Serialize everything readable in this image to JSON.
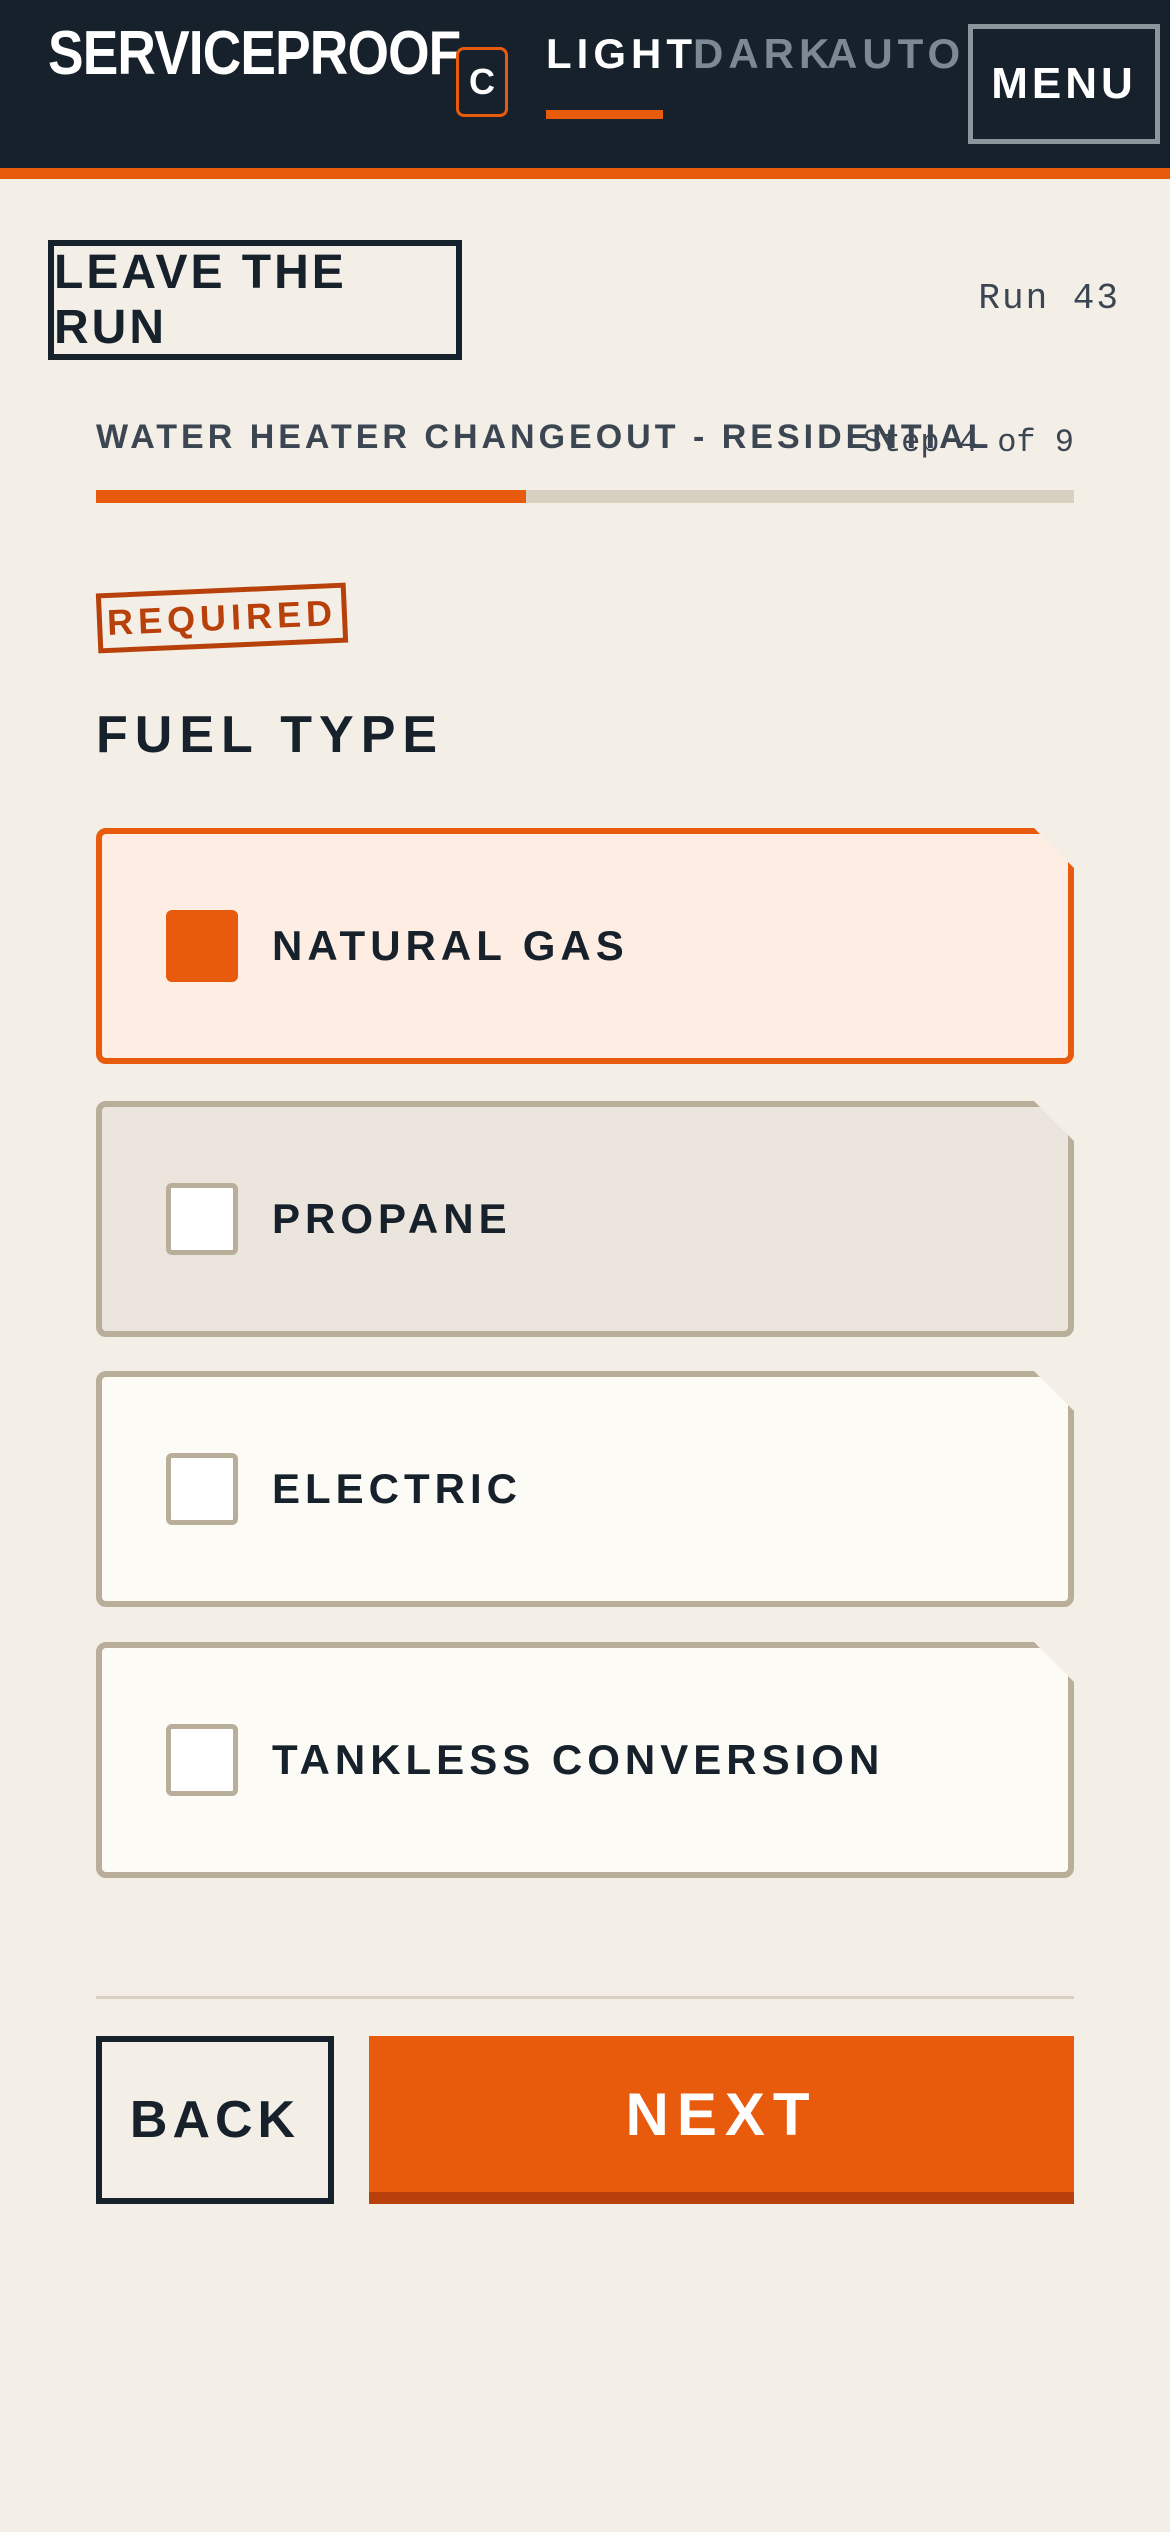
{
  "header": {
    "brand": "SERVICEPROOF",
    "theme_chip": "C",
    "tabs": [
      {
        "label": "LIGHT",
        "active": true
      },
      {
        "label": "DARK",
        "active": false
      },
      {
        "label": "AUTO",
        "active": false
      }
    ],
    "menu_label": "MENU"
  },
  "run": {
    "leave_label": "LEAVE THE RUN",
    "run_number": "Run 43",
    "task_title": "WATER HEATER CHANGEOUT - RESIDENTIAL",
    "step_text": "Step 4 of 9",
    "progress_fraction": 0.44
  },
  "question": {
    "badge": "REQUIRED",
    "title": "FUEL TYPE",
    "options": [
      {
        "label": "NATURAL GAS",
        "selected": true
      },
      {
        "label": "PROPANE",
        "selected": false
      },
      {
        "label": "ELECTRIC",
        "selected": false
      },
      {
        "label": "TANKLESS CONVERSION",
        "selected": false
      }
    ]
  },
  "footer": {
    "back_label": "BACK",
    "next_label": "NEXT"
  },
  "colors": {
    "accent": "#e85a0c",
    "header_bg": "#17212b",
    "page_bg": "#f3eee6",
    "stamp": "#b8400a"
  }
}
